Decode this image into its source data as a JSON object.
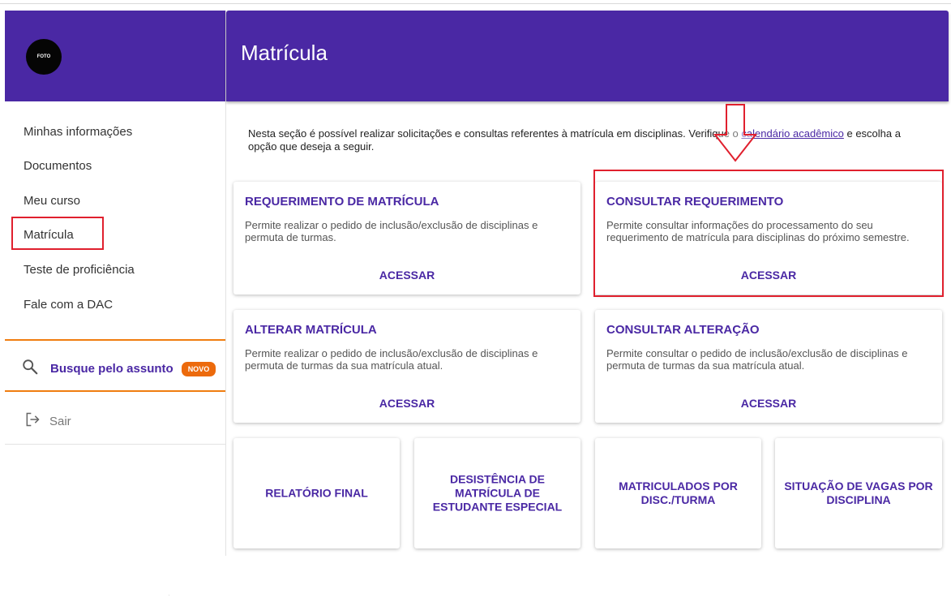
{
  "sidebar": {
    "avatar_label": "FOTO",
    "items": [
      {
        "label": "Minhas informações"
      },
      {
        "label": "Documentos"
      },
      {
        "label": "Meu curso"
      },
      {
        "label": "Matrícula"
      },
      {
        "label": "Teste de proficiência"
      },
      {
        "label": "Fale com a DAC"
      }
    ],
    "search_label": "Busque pelo assunto",
    "search_badge": "NOVO",
    "logout_label": "Sair"
  },
  "header": {
    "title": "Matrícula"
  },
  "intro": {
    "text_before": "Nesta seção é possível realizar solicitações e consultas referentes à matrícula em disciplinas. Verifique o ",
    "link": "calendário acadêmico",
    "text_after": " e escolha a opção que deseja a seguir."
  },
  "cards": [
    {
      "title": "REQUERIMENTO DE MATRÍCULA",
      "desc": "Permite realizar o pedido de inclusão/exclusão de disciplinas e permuta de turmas.",
      "action": "ACESSAR"
    },
    {
      "title": "CONSULTAR REQUERIMENTO",
      "desc": "Permite consultar informações do processamento do seu requerimento de matrícula para disciplinas do próximo semestre.",
      "action": "ACESSAR"
    },
    {
      "title": "ALTERAR MATRÍCULA",
      "desc": "Permite realizar o pedido de inclusão/exclusão de disciplinas e permuta de turmas da sua matrícula atual.",
      "action": "ACESSAR"
    },
    {
      "title": "CONSULTAR ALTERAÇÃO",
      "desc": "Permite consultar o pedido de inclusão/exclusão de disciplinas e permuta de turmas da sua matrícula atual.",
      "action": "ACESSAR"
    }
  ],
  "small_cards": [
    {
      "title": "RELATÓRIO FINAL"
    },
    {
      "title": "DESISTÊNCIA DE MATRÍCULA DE ESTUDANTE ESPECIAL"
    },
    {
      "title": "MATRICULADOS POR DISC./TURMA"
    },
    {
      "title": "SITUAÇÃO DE VAGAS POR DISCIPLINA"
    }
  ],
  "colors": {
    "brand": "#4a28a4",
    "accent": "#f07d10",
    "annotation": "#e0202e"
  }
}
